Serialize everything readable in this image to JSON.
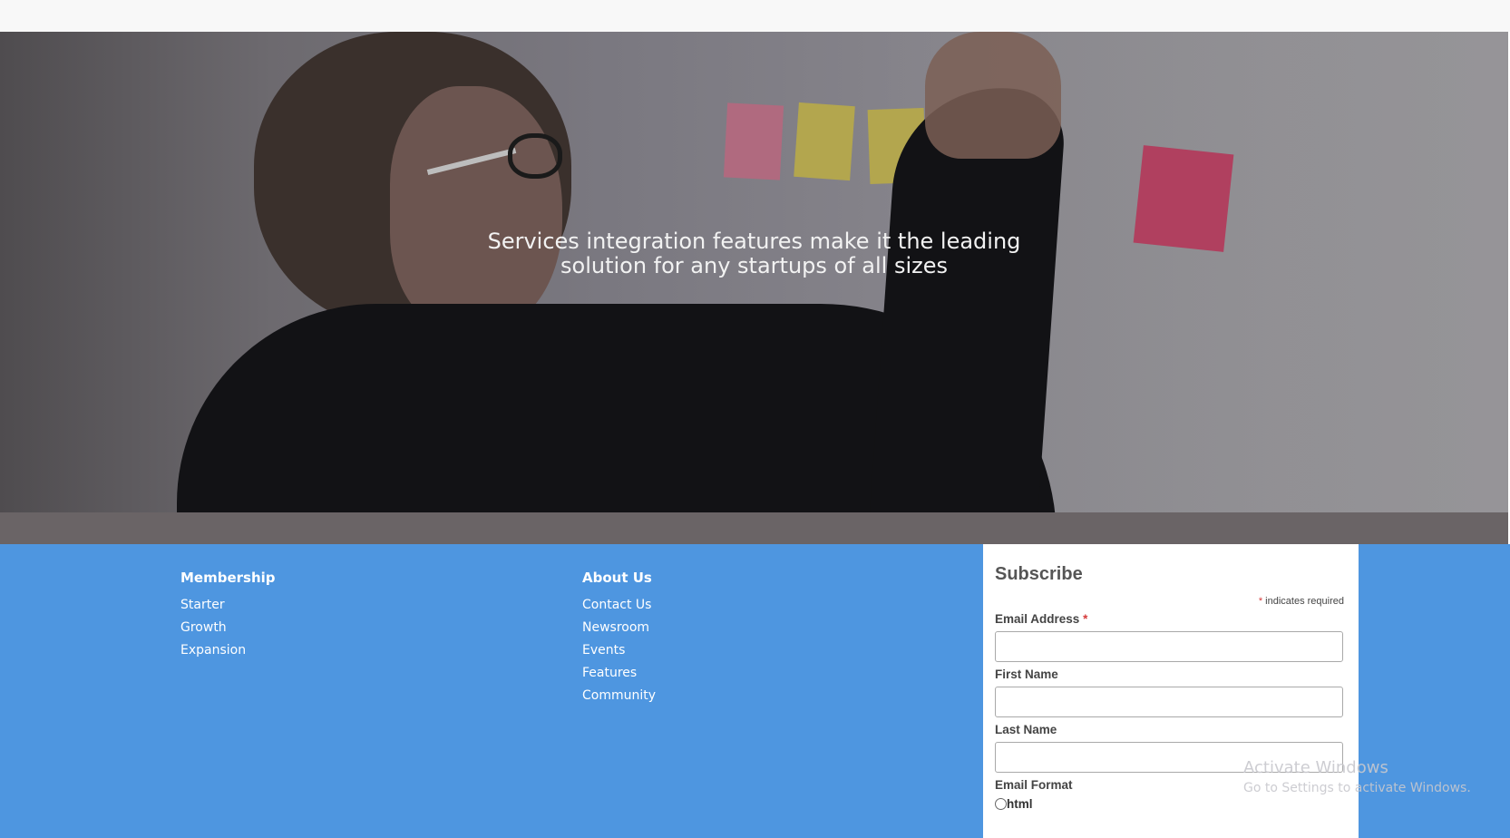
{
  "hero": {
    "line1": "Services integration features make it the leading",
    "line2": "solution for any startups of all sizes"
  },
  "footer": {
    "membership": {
      "heading": "Membership",
      "links": [
        "Starter",
        "Growth",
        "Expansion"
      ]
    },
    "about": {
      "heading": "About Us",
      "links": [
        "Contact Us",
        "Newsroom",
        "Events",
        "Features",
        "Community"
      ]
    }
  },
  "subscribe": {
    "title": "Subscribe",
    "required_star": "*",
    "required_note": "indicates required",
    "email_label": "Email Address",
    "first_name_label": "First Name",
    "last_name_label": "Last Name",
    "email_format_label": "Email Format",
    "format_option_html": "html"
  },
  "watermark": {
    "title": "Activate Windows",
    "subtitle": "Go to Settings to activate Windows."
  },
  "colors": {
    "footer_bg": "#4e96e0",
    "required_star": "#d63b3b",
    "topbar_bg": "#f8f8f8"
  }
}
